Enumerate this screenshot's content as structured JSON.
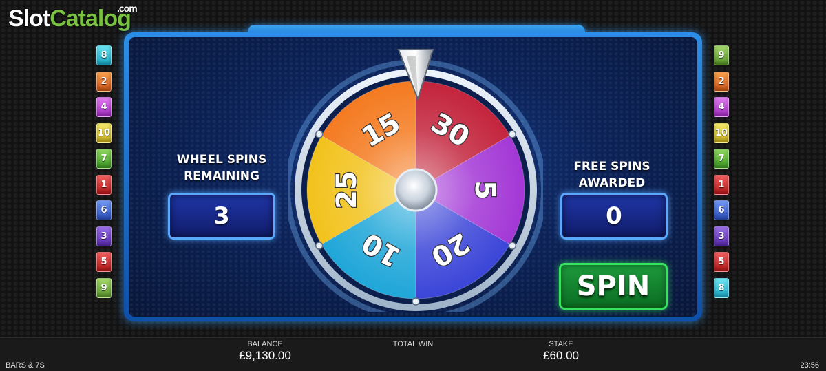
{
  "logo": {
    "slot": "Slot",
    "catalog": "Catalog",
    "com": ".com"
  },
  "left_column": [
    {
      "n": "8",
      "c": "cyan"
    },
    {
      "n": "2",
      "c": "orange"
    },
    {
      "n": "4",
      "c": "magenta"
    },
    {
      "n": "10",
      "c": "yellow"
    },
    {
      "n": "7",
      "c": "green"
    },
    {
      "n": "1",
      "c": "red"
    },
    {
      "n": "6",
      "c": "blue"
    },
    {
      "n": "3",
      "c": "purple"
    },
    {
      "n": "5",
      "c": "red"
    },
    {
      "n": "9",
      "c": "lime"
    }
  ],
  "right_column": [
    {
      "n": "9",
      "c": "lime"
    },
    {
      "n": "2",
      "c": "orange"
    },
    {
      "n": "4",
      "c": "magenta"
    },
    {
      "n": "10",
      "c": "yellow"
    },
    {
      "n": "7",
      "c": "green"
    },
    {
      "n": "1",
      "c": "red"
    },
    {
      "n": "6",
      "c": "blue"
    },
    {
      "n": "3",
      "c": "purple"
    },
    {
      "n": "5",
      "c": "red"
    },
    {
      "n": "8",
      "c": "cyan"
    }
  ],
  "wheel_spins": {
    "label_line1": "WHEEL SPINS",
    "label_line2": "REMAINING",
    "value": "3"
  },
  "free_spins": {
    "label_line1": "FREE SPINS",
    "label_line2": "AWARDED",
    "value": "0"
  },
  "spin_button": {
    "label": "SPIN"
  },
  "wheel": {
    "segments": [
      {
        "value": "30",
        "color": "#c3243c"
      },
      {
        "value": "5",
        "color": "#a337d6"
      },
      {
        "value": "20",
        "color": "#3b45d8"
      },
      {
        "value": "10",
        "color": "#1fa6d8"
      },
      {
        "value": "25",
        "color": "#f2c21c"
      },
      {
        "value": "15",
        "color": "#f47a20"
      }
    ]
  },
  "footer": {
    "balance_label": "BALANCE",
    "balance_value": "£9,130.00",
    "total_win_label": "TOTAL WIN",
    "stake_label": "STAKE",
    "stake_value": "£60.00",
    "game_name": "BARS & 7S",
    "clock": "23:56"
  }
}
